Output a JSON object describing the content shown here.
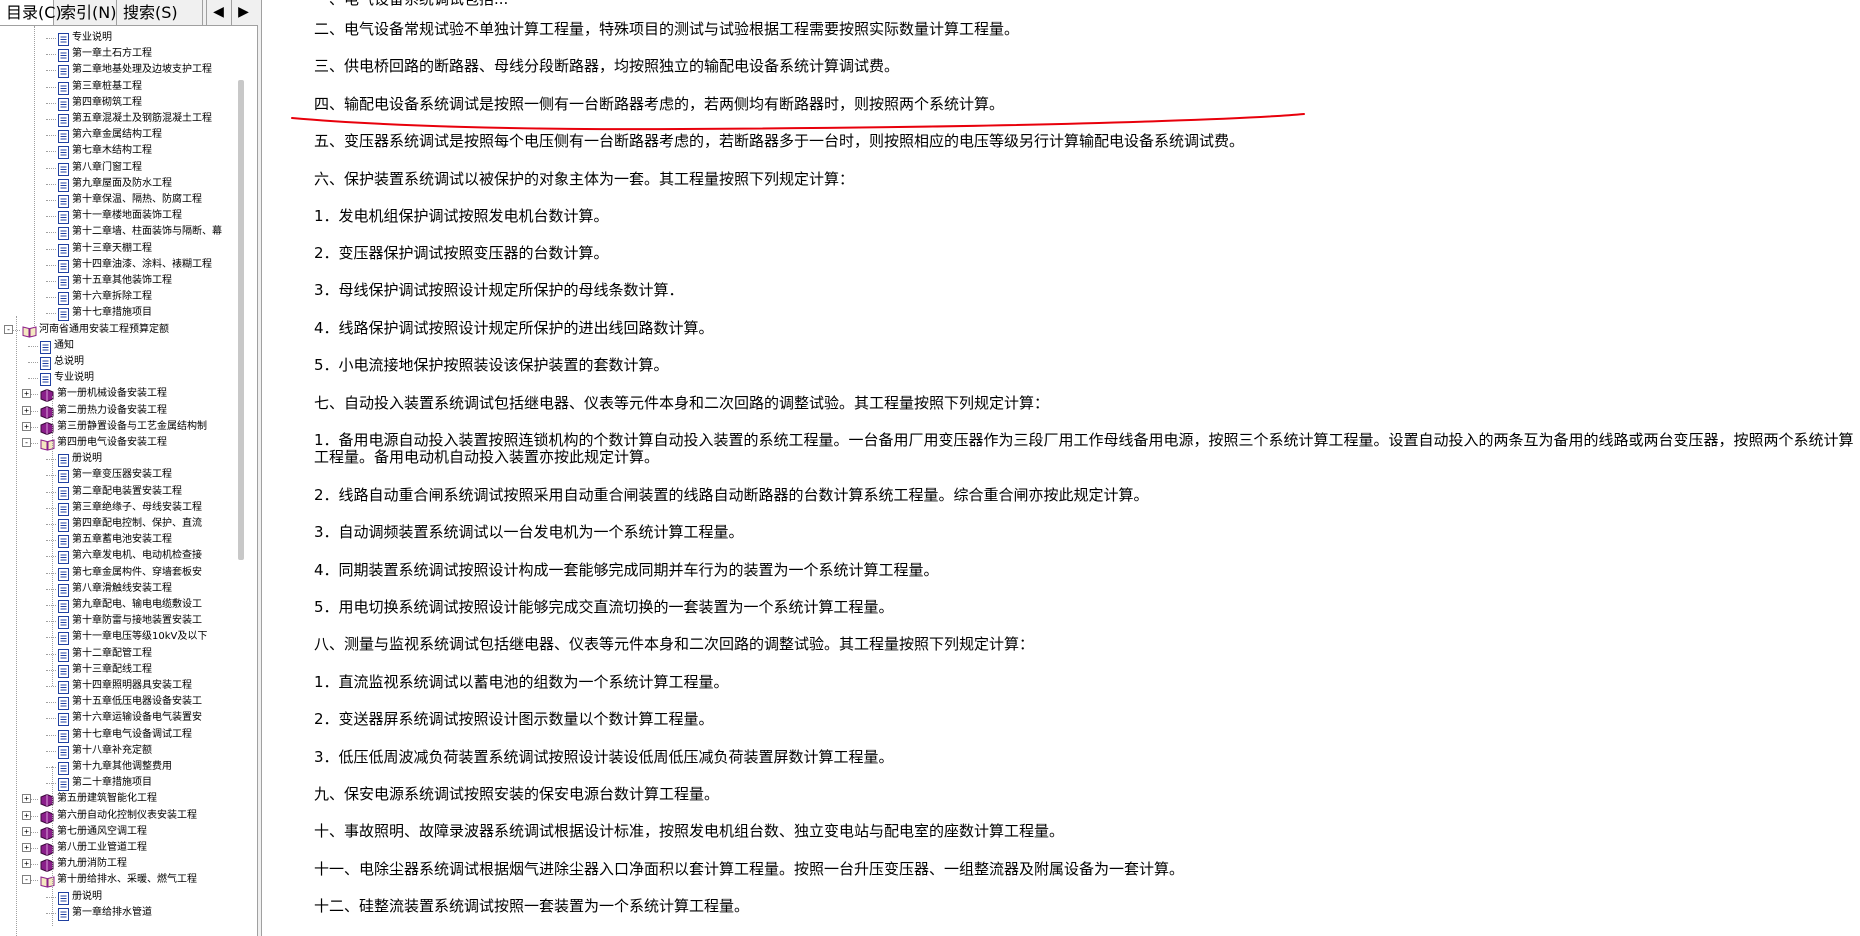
{
  "tabs": [
    {
      "label": "目录(C)",
      "active": true
    },
    {
      "label": "索引(N)",
      "active": false
    },
    {
      "label": "搜索(S)",
      "active": false
    }
  ],
  "tab_scroll": {
    "left": "◀",
    "right": "▶"
  },
  "tree": [
    {
      "label": "专业说明",
      "level": 3,
      "type": "page"
    },
    {
      "label": "第一章土石方工程",
      "level": 3,
      "type": "page"
    },
    {
      "label": "第二章地基处理及边坡支护工程",
      "level": 3,
      "type": "page"
    },
    {
      "label": "第三章桩基工程",
      "level": 3,
      "type": "page"
    },
    {
      "label": "第四章砌筑工程",
      "level": 3,
      "type": "page"
    },
    {
      "label": "第五章混凝土及钢筋混凝土工程",
      "level": 3,
      "type": "page"
    },
    {
      "label": "第六章金属结构工程",
      "level": 3,
      "type": "page"
    },
    {
      "label": "第七章木结构工程",
      "level": 3,
      "type": "page"
    },
    {
      "label": "第八章门窗工程",
      "level": 3,
      "type": "page"
    },
    {
      "label": "第九章屋面及防水工程",
      "level": 3,
      "type": "page"
    },
    {
      "label": "第十章保温、隔热、防腐工程",
      "level": 3,
      "type": "page"
    },
    {
      "label": "第十一章楼地面装饰工程",
      "level": 3,
      "type": "page"
    },
    {
      "label": "第十二章墙、柱面装饰与隔断、幕",
      "level": 3,
      "type": "page"
    },
    {
      "label": "第十三章天棚工程",
      "level": 3,
      "type": "page"
    },
    {
      "label": "第十四章油漆、涂料、裱糊工程",
      "level": 3,
      "type": "page"
    },
    {
      "label": "第十五章其他装饰工程",
      "level": 3,
      "type": "page"
    },
    {
      "label": "第十六章拆除工程",
      "level": 3,
      "type": "page"
    },
    {
      "label": "第十七章措施项目",
      "level": 3,
      "type": "page"
    },
    {
      "label": "河南省通用安装工程预算定额",
      "level": 1,
      "type": "book-open",
      "expander": "-"
    },
    {
      "label": "通知",
      "level": 2,
      "type": "page"
    },
    {
      "label": "总说明",
      "level": 2,
      "type": "page"
    },
    {
      "label": "专业说明",
      "level": 2,
      "type": "page"
    },
    {
      "label": "第一册机械设备安装工程",
      "level": 2,
      "type": "book",
      "expander": "+"
    },
    {
      "label": "第二册热力设备安装工程",
      "level": 2,
      "type": "book",
      "expander": "+"
    },
    {
      "label": "第三册静置设备与工艺金属结构制",
      "level": 2,
      "type": "book",
      "expander": "+"
    },
    {
      "label": "第四册电气设备安装工程",
      "level": 2,
      "type": "book-open",
      "expander": "-"
    },
    {
      "label": "册说明",
      "level": 3,
      "type": "page"
    },
    {
      "label": "第一章变压器安装工程",
      "level": 3,
      "type": "page"
    },
    {
      "label": "第二章配电装置安装工程",
      "level": 3,
      "type": "page"
    },
    {
      "label": "第三章绝缘子、母线安装工程",
      "level": 3,
      "type": "page"
    },
    {
      "label": "第四章配电控制、保护、直流",
      "level": 3,
      "type": "page"
    },
    {
      "label": "第五章蓄电池安装工程",
      "level": 3,
      "type": "page"
    },
    {
      "label": "第六章发电机、电动机检查接",
      "level": 3,
      "type": "page"
    },
    {
      "label": "第七章金属构件、穿墙套板安",
      "level": 3,
      "type": "page"
    },
    {
      "label": "第八章滑触线安装工程",
      "level": 3,
      "type": "page"
    },
    {
      "label": "第九章配电、输电电缆敷设工",
      "level": 3,
      "type": "page"
    },
    {
      "label": "第十章防雷与接地装置安装工",
      "level": 3,
      "type": "page"
    },
    {
      "label": "第十一章电压等级10kV及以下",
      "level": 3,
      "type": "page"
    },
    {
      "label": "第十二章配管工程",
      "level": 3,
      "type": "page"
    },
    {
      "label": "第十三章配线工程",
      "level": 3,
      "type": "page"
    },
    {
      "label": "第十四章照明器具安装工程",
      "level": 3,
      "type": "page"
    },
    {
      "label": "第十五章低压电器设备安装工",
      "level": 3,
      "type": "page"
    },
    {
      "label": "第十六章运输设备电气装置安",
      "level": 3,
      "type": "page"
    },
    {
      "label": "第十七章电气设备调试工程",
      "level": 3,
      "type": "page"
    },
    {
      "label": "第十八章补充定额",
      "level": 3,
      "type": "page"
    },
    {
      "label": "第十九章其他调整费用",
      "level": 3,
      "type": "page"
    },
    {
      "label": "第二十章措施项目",
      "level": 3,
      "type": "page"
    },
    {
      "label": "第五册建筑智能化工程",
      "level": 2,
      "type": "book",
      "expander": "+"
    },
    {
      "label": "第六册自动化控制仪表安装工程",
      "level": 2,
      "type": "book",
      "expander": "+"
    },
    {
      "label": "第七册通风空调工程",
      "level": 2,
      "type": "book",
      "expander": "+"
    },
    {
      "label": "第八册工业管道工程",
      "level": 2,
      "type": "book",
      "expander": "+"
    },
    {
      "label": "第九册消防工程",
      "level": 2,
      "type": "book",
      "expander": "+"
    },
    {
      "label": "第十册给排水、采暖、燃气工程",
      "level": 2,
      "type": "book-open",
      "expander": "-"
    },
    {
      "label": "册说明",
      "level": 3,
      "type": "page"
    },
    {
      "label": "第一章给排水管道",
      "level": 3,
      "type": "page"
    }
  ],
  "content": [
    "二、电气设备常规试验不单独计算工程量，特殊项目的测试与试验根据工程需要按照实际数量计算工程量。",
    "三、供电桥回路的断路器、母线分段断路器，均按照独立的输配电设备系统计算调试费。",
    "四、输配电设备系统调试是按照一侧有一台断路器考虑的，若两侧均有断路器时，则按照两个系统计算。",
    "五、变压器系统调试是按照每个电压侧有一台断路器考虑的，若断路器多于一台时，则按照相应的电压等级另行计算输配电设备系统调试费。",
    "六、保护装置系统调试以被保护的对象主体为一套。其工程量按照下列规定计算：",
    "1．发电机组保护调试按照发电机台数计算。",
    "2．变压器保护调试按照变压器的台数计算。",
    "3．母线保护调试按照设计规定所保护的母线条数计算．",
    "4．线路保护调试按照设计规定所保护的进出线回路数计算。",
    "5．小电流接地保护按照装设该保护装置的套数计算。",
    "七、自动投入装置系统调试包括继电器、仪表等元件本身和二次回路的调整试验。其工程量按照下列规定计算：",
    "1．备用电源自动投入装置按照连锁机构的个数计算自动投入装置的系统工程量。一台备用厂用变压器作为三段厂用工作母线备用电源，按照三个系统计算工程量。设置自动投入的两条互为备用的线路或两台变压器，按照两个系统计算工程量。备用电动机自动投入装置亦按此规定计算。",
    "2．线路自动重合闸系统调试按照采用自动重合闸装置的线路自动断路器的台数计算系统工程量。综合重合闸亦按此规定计算。",
    "3．自动调频装置系统调试以一台发电机为一个系统计算工程量。",
    "4．同期装置系统调试按照设计构成一套能够完成同期并车行为的装置为一个系统计算工程量。",
    "5．用电切换系统调试按照设计能够完成交直流切换的一套装置为一个系统计算工程量。",
    "八、测量与监视系统调试包括继电器、仪表等元件本身和二次回路的调整试验。其工程量按照下列规定计算：",
    "1．直流监视系统调试以蓄电池的组数为一个系统计算工程量。",
    "2．变送器屏系统调试按照设计图示数量以个数计算工程量。",
    "3．低压低周波减负荷装置系统调试按照设计装设低周低压减负荷装置屏数计算工程量。",
    "九、保安电源系统调试按照安装的保安电源台数计算工程量。",
    "十、事故照明、故障录波器系统调试根据设计标准，按照发电机组台数、独立变电站与配电室的座数计算工程量。",
    "十一、电除尘器系统调试根据烟气进除尘器入口净面积以套计算工程量。按照一台升压变压器、一组整流器及附属设备为一套计算。",
    "十二、硅整流装置系统调试按照一套装置为一个系统计算工程量。"
  ],
  "colors": {
    "underline": "#e8000b",
    "book": "#8a1e8a",
    "page": "#2040a0"
  }
}
